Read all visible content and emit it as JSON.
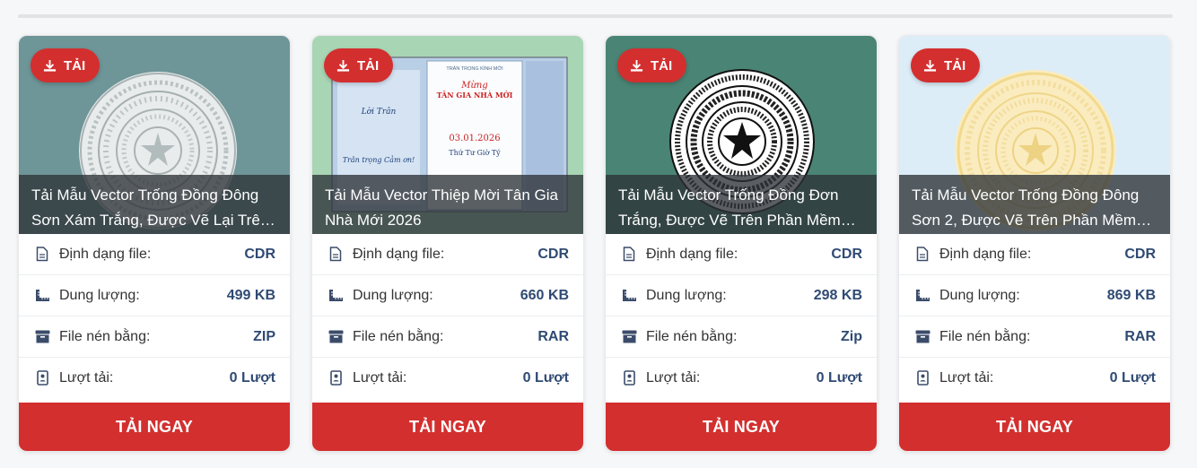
{
  "cards": [
    {
      "badge": "TẢI",
      "title": "Tải Mẫu Vector Trống Đồng Đông Sơn Xám Trắng, Được Vẽ Lại Trên Phần Mềm…",
      "rows": [
        {
          "label": "Định dạng file:",
          "value": "CDR"
        },
        {
          "label": "Dung lượng:",
          "value": "499 KB"
        },
        {
          "label": "File nén bằng:",
          "value": "ZIP"
        },
        {
          "label": "Lượt tải:",
          "value": "0 Lượt"
        }
      ],
      "button": "TẢI NGAY"
    },
    {
      "badge": "TẢI",
      "title": "Tải Mẫu Vector Thiệp Mời Tân Gia Nhà Mới 2026",
      "rows": [
        {
          "label": "Định dạng file:",
          "value": "CDR"
        },
        {
          "label": "Dung lượng:",
          "value": "660 KB"
        },
        {
          "label": "File nén bằng:",
          "value": "RAR"
        },
        {
          "label": "Lượt tải:",
          "value": "0 Lượt"
        }
      ],
      "button": "TẢI NGAY",
      "invite": {
        "left_title": "Lời Trân",
        "left_footer": "Trân trọng Cảm ơn!",
        "header": "TRÂN TRỌNG KÍNH MỜI",
        "script": "Mừng",
        "headline": "TÂN GIA NHÀ MỚI",
        "date": "03.01.2026",
        "footer": "Thứ Tư Giờ Tý"
      }
    },
    {
      "badge": "TẢI",
      "title": "Tải Mẫu Vector Trống Đồng Đơn Trắng, Được Vẽ Trên Phần Mềm Corel…",
      "rows": [
        {
          "label": "Định dạng file:",
          "value": "CDR"
        },
        {
          "label": "Dung lượng:",
          "value": "298 KB"
        },
        {
          "label": "File nén bằng:",
          "value": "Zip"
        },
        {
          "label": "Lượt tải:",
          "value": "0 Lượt"
        }
      ],
      "button": "TẢI NGAY"
    },
    {
      "badge": "TẢI",
      "title": "Tải Mẫu Vector Trống Đồng Đông Sơn 2, Được Vẽ Trên Phần Mềm Corel…",
      "rows": [
        {
          "label": "Định dạng file:",
          "value": "CDR"
        },
        {
          "label": "Dung lượng:",
          "value": "869 KB"
        },
        {
          "label": "File nén bằng:",
          "value": "RAR"
        },
        {
          "label": "Lượt tải:",
          "value": "0 Lượt"
        }
      ],
      "button": "TẢI NGAY"
    }
  ],
  "icons": {
    "badge": "download-icon",
    "format": "file-icon",
    "size": "ruler-icon",
    "archive": "archive-box-icon",
    "downloads": "counter-badge-icon"
  },
  "colors": {
    "accent": "#d32f2f",
    "value_text": "#2f4a73",
    "card_bg_1": "#6e9598",
    "card_bg_2": "#a8d5b4",
    "card_bg_3": "#4a8474",
    "card_bg_4": "#dcedf7"
  }
}
